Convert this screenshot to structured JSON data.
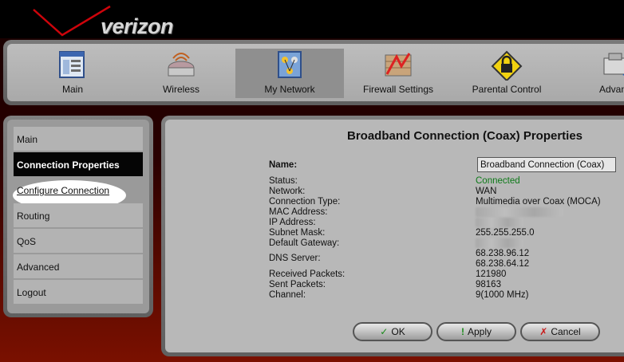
{
  "brand": {
    "logo_text": "verizon"
  },
  "topnav": {
    "items": [
      {
        "label": "Main",
        "icon": "main-window-icon"
      },
      {
        "label": "Wireless",
        "icon": "wireless-router-icon"
      },
      {
        "label": "My Network",
        "icon": "network-icon"
      },
      {
        "label": "Firewall Settings",
        "icon": "firewall-icon"
      },
      {
        "label": "Parental Control",
        "icon": "parental-warning-icon"
      },
      {
        "label": "Advanc",
        "icon": "advanced-icon"
      }
    ],
    "active_index": 2
  },
  "sidebar": {
    "items": [
      {
        "label": "Main"
      },
      {
        "label": "Connection Properties"
      },
      {
        "label": "Configure Connection"
      },
      {
        "label": "Routing"
      },
      {
        "label": "QoS"
      },
      {
        "label": "Advanced"
      },
      {
        "label": "Logout"
      }
    ]
  },
  "panel": {
    "title": "Broadband Connection (Coax) Properties",
    "name_label": "Name:",
    "name_value": "Broadband Connection (Coax)",
    "rows": {
      "status": {
        "label": "Status:",
        "value": "Connected"
      },
      "network": {
        "label": "Network:",
        "value": "WAN"
      },
      "connection_type": {
        "label": "Connection Type:",
        "value": "Multimedia over Coax (MOCA)"
      },
      "mac": {
        "label": "MAC Address:"
      },
      "ip": {
        "label": "IP Address:"
      },
      "subnet": {
        "label": "Subnet Mask:",
        "value": "255.255.255.0"
      },
      "gateway": {
        "label": "Default Gateway:"
      },
      "dns": {
        "label": "DNS Server:",
        "value1": "68.238.96.12",
        "value2": "68.238.64.12"
      },
      "rx": {
        "label": "Received Packets:",
        "value": "121980"
      },
      "tx": {
        "label": "Sent Packets:",
        "value": "98163"
      },
      "channel": {
        "label": "Channel:",
        "value": "9(1000 MHz)"
      }
    },
    "buttons": {
      "ok": "OK",
      "apply": "Apply",
      "cancel": "Cancel"
    }
  },
  "colors": {
    "connected": "#0d7a18",
    "brand_red": "#cd040b"
  }
}
